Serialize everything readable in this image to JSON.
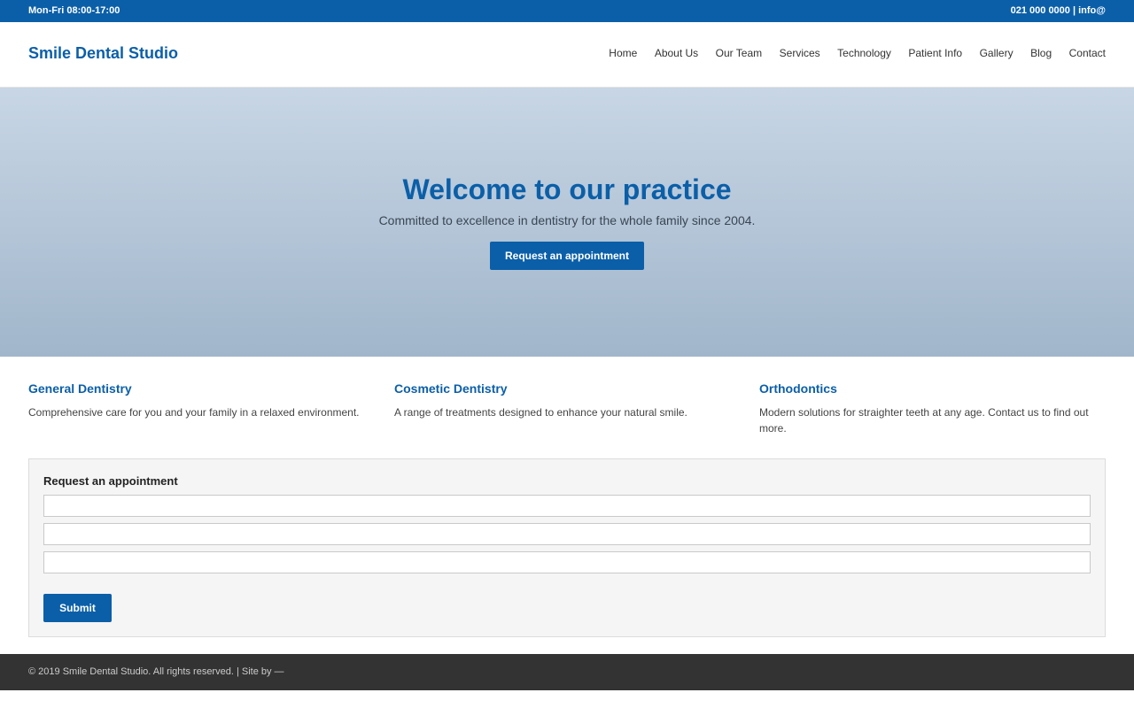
{
  "topbar": {
    "hours": "Mon-Fri 08:00-17:00",
    "contact": "021 000 0000 | info@"
  },
  "header": {
    "logo": "Smile Dental Studio",
    "nav": [
      "Home",
      "About Us",
      "Our Team",
      "Services",
      "Technology",
      "Patient Info",
      "Gallery",
      "Blog",
      "Contact"
    ]
  },
  "hero": {
    "title": "Welcome to our practice",
    "subtitle": "Committed to excellence in dentistry for the whole family since 2004.",
    "cta_label": "Request an appointment"
  },
  "features": [
    {
      "title": "General Dentistry",
      "text": "Comprehensive care for you and your family in a relaxed environment."
    },
    {
      "title": "Cosmetic Dentistry",
      "text": "A range of treatments designed to enhance your natural smile."
    },
    {
      "title": "Orthodontics",
      "text": "Modern solutions for straighter teeth at any age. Contact us to find out more."
    }
  ],
  "appointment_form": {
    "title": "Request an appointment",
    "fields": [
      {
        "value": "",
        "placeholder": ""
      },
      {
        "value": "",
        "placeholder": ""
      },
      {
        "value": "",
        "placeholder": ""
      }
    ],
    "submit_label": "Submit"
  },
  "footer": {
    "text": "© 2019 Smile Dental Studio. All rights reserved. | Site by —"
  },
  "colors": {
    "brand": "#0b5fa8",
    "footer": "#333333",
    "hero_top": "#c8d6e5",
    "hero_bottom": "#a1b6cb"
  }
}
